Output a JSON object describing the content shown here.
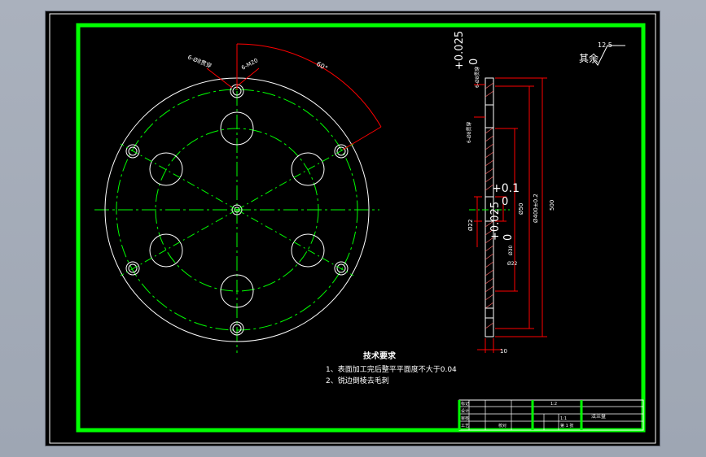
{
  "drawing": {
    "colors": {
      "background": "#000000",
      "frame": "#00ff00",
      "outline": "#ffffff",
      "centerline": "#00ff00",
      "dimension": "#ff0000",
      "text": "#ffffff",
      "roughness": "#ffffff"
    },
    "front_view": {
      "label_holes_small": "6-Ø8贯穿",
      "label_thread": "6-M20",
      "label_angle": "60°"
    },
    "tolerances": {
      "upper_a": "+0.025",
      "lower_a": "0",
      "upper_b": "+0.1",
      "lower_b": "0",
      "upper_c": "+0.025",
      "lower_c": "0"
    },
    "section_view": {
      "label_top_holes": "6-Ø8贯穿",
      "label_mid_holes": "6-Ø8贯穿",
      "dim_22": "Ø22",
      "dim_30": "Ø30",
      "dim_small": "Ø22",
      "dim_50": "Ø50",
      "dim_400": "Ø400±0.2",
      "dim_500": "500",
      "dim_thickness": "10"
    },
    "roughness": {
      "value": "12.5",
      "label": "其余"
    },
    "notes": {
      "title": "技术要求",
      "items": [
        "1、表面加工完后整平平面度不大于0.04",
        "2、锐边倒棱去毛刺"
      ]
    },
    "title_block": {
      "scale_label": "1:2",
      "ratio": "1:1",
      "sheet": "第 1 张",
      "drawing_name": "法兰盘",
      "row_labels": [
        "标记",
        "设计",
        "审核",
        "工艺"
      ],
      "designer": "校对"
    }
  }
}
